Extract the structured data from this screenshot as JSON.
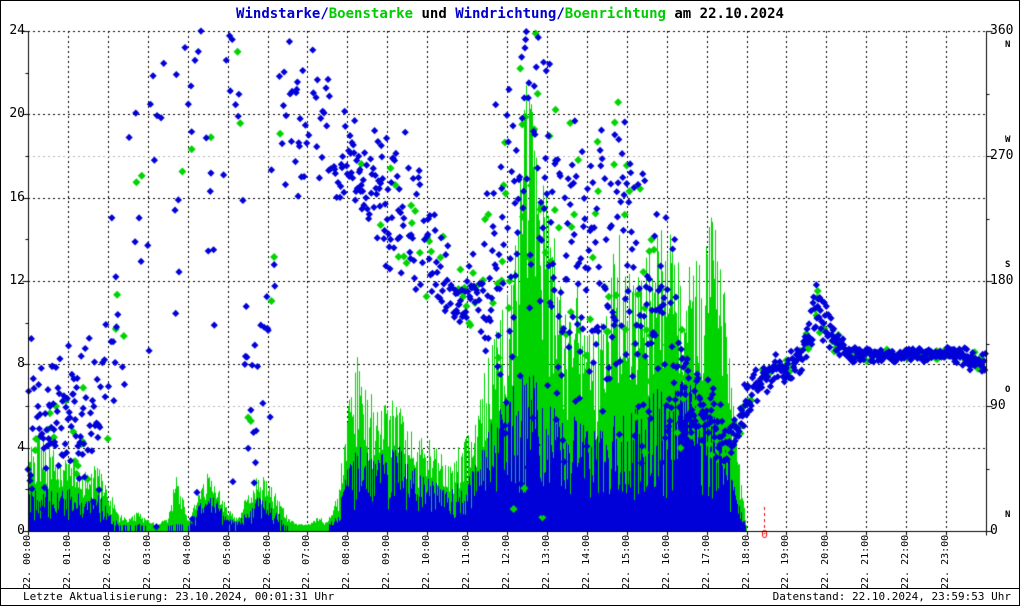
{
  "title": {
    "part_wind": "Windstarke/",
    "part_gust": "Boenstarke",
    "part_mid": " und ",
    "part_winddir": "Windrichtung/",
    "part_gustdir": "Boenrichtung",
    "part_date": " am 22.10.2024"
  },
  "footer": {
    "left": "Letzte Aktualisierung: 23.10.2024, 00:01:31 Uhr",
    "right": "Datenstand: 22.10.2024, 23:59:53 Uhr"
  },
  "colors": {
    "wind": "#0000d8",
    "gust": "#00d400",
    "title_blue": "#0000cc",
    "title_green": "#00cc00",
    "grid_major": "#000000",
    "grid_minor": "#b8b8b8",
    "annotation_red": "#ff0000"
  },
  "axes": {
    "left_ticks": [
      0,
      4,
      8,
      12,
      16,
      20,
      24
    ],
    "right_ticks": [
      {
        "value": 0,
        "compass": "N"
      },
      {
        "value": 90,
        "compass": "O"
      },
      {
        "value": 180,
        "compass": "S"
      },
      {
        "value": 270,
        "compass": "W"
      },
      {
        "value": 360,
        "compass": "N"
      }
    ],
    "x_labels": [
      "22. 00:00",
      "22. 01:00",
      "22. 02:00",
      "22. 03:00",
      "22. 04:00",
      "22. 05:00",
      "22. 06:00",
      "22. 07:00",
      "22. 08:00",
      "22. 09:00",
      "22. 10:00",
      "22. 11:00",
      "22. 12:00",
      "22. 13:00",
      "22. 14:00",
      "22. 15:00",
      "22. 16:00",
      "22. 17:00",
      "22. 18:00",
      "22. 19:00",
      "22. 20:00",
      "22. 21:00",
      "22. 22:00",
      "22. 23:00"
    ]
  },
  "annotation": {
    "red_zero": {
      "hour": 18.45,
      "label": "0"
    }
  },
  "chart_data": {
    "type": "mixed",
    "subtypes": {
      "speed_series": "bar",
      "direction_series": "scatter"
    },
    "x_unit": "hour_of_day",
    "xlim": [
      0,
      24
    ],
    "ylim_left": [
      0,
      24
    ],
    "ylim_right": [
      0,
      360
    ],
    "grid": "dashed_major_every_4_left_and_hourly",
    "minor_grid_at_degrees": [
      90,
      270
    ],
    "anchor_step_hours": 0.25,
    "speed_data_ends_hour": 18.1,
    "seed": 42,
    "series": [
      {
        "name": "Windstarke",
        "role": "wind_speed_bars",
        "color": "#0000d8",
        "avg": [
          1.5,
          1.8,
          1.6,
          1.4,
          1.7,
          1.5,
          1.2,
          1.4,
          1.0,
          0.3,
          0.2,
          0.3,
          0.2,
          0.1,
          0.2,
          0.3,
          0.2,
          0.9,
          1.4,
          1.1,
          0.5,
          0.3,
          0.9,
          1.3,
          1.2,
          0.8,
          0.2,
          0.1,
          0.1,
          0.2,
          0.2,
          0.6,
          2.6,
          3.1,
          3.2,
          2.8,
          3.0,
          3.3,
          2.6,
          2.2,
          2.4,
          1.8,
          1.5,
          1.8,
          2.0,
          2.6,
          3.6,
          4.6,
          5.0,
          5.6,
          6.2,
          5.6,
          5.0,
          4.6,
          4.0,
          4.4,
          4.0,
          3.6,
          4.0,
          4.6,
          4.2,
          4.6,
          5.0,
          5.4,
          5.0,
          5.6,
          6.0,
          5.4,
          5.0,
          4.2,
          3.0,
          1.4,
          0,
          0,
          0,
          0,
          0,
          0,
          0,
          0,
          0,
          0,
          0,
          0,
          0,
          0,
          0,
          0,
          0,
          0,
          0,
          0,
          0,
          0,
          0,
          0
        ]
      },
      {
        "name": "Boenstarke",
        "role": "gust_speed_bars",
        "color": "#00d400",
        "avg": [
          3.6,
          4.6,
          4.0,
          3.0,
          3.4,
          3.0,
          2.6,
          3.0,
          2.0,
          0.8,
          0.5,
          0.9,
          0.5,
          0.3,
          0.7,
          2.8,
          0.4,
          1.6,
          2.6,
          2.0,
          1.0,
          0.6,
          1.8,
          2.6,
          2.2,
          1.5,
          0.6,
          0.3,
          0.3,
          0.6,
          0.5,
          1.6,
          5.6,
          7.6,
          6.6,
          5.2,
          5.6,
          6.0,
          4.6,
          4.0,
          4.6,
          3.6,
          3.0,
          3.6,
          4.2,
          5.6,
          7.6,
          9.2,
          10.5,
          14.5,
          20.5,
          17.5,
          14.5,
          12.0,
          10.0,
          11.0,
          9.5,
          8.6,
          10.5,
          13.5,
          12.0,
          11.0,
          12.5,
          13.0,
          13.5,
          12.0,
          11.5,
          12.5,
          13.0,
          15.0,
          9.0,
          4.0,
          0,
          0,
          0,
          0,
          0,
          0,
          0,
          0,
          0,
          0,
          0,
          0,
          0,
          0,
          0,
          0,
          0,
          0,
          0,
          0,
          0,
          0,
          0,
          0
        ]
      },
      {
        "name": "Windrichtung",
        "role": "wind_direction_points",
        "color": "#0000d8",
        "center": [
          75,
          85,
          70,
          90,
          80,
          72,
          95,
          85,
          100,
          150,
          200,
          240,
          230,
          300,
          330,
          210,
          320,
          340,
          300,
          90,
          350,
          340,
          70,
          95,
          130,
          280,
          320,
          300,
          300,
          310,
          285,
          260,
          258,
          263,
          256,
          248,
          240,
          234,
          224,
          214,
          205,
          190,
          176,
          168,
          166,
          172,
          182,
          192,
          205,
          235,
          280,
          320,
          215,
          195,
          175,
          185,
          178,
          192,
          205,
          195,
          182,
          172,
          162,
          152,
          142,
          122,
          102,
          92,
          82,
          72,
          64,
          76,
          92,
          102,
          112,
          116,
          118,
          121,
          138,
          162,
          150,
          136,
          129,
          127,
          128,
          126,
          127,
          126,
          127,
          128,
          126,
          127,
          128,
          127,
          125,
          122
        ],
        "spread": [
          45,
          45,
          42,
          42,
          42,
          40,
          45,
          48,
          60,
          80,
          90,
          90,
          80,
          60,
          50,
          70,
          50,
          40,
          70,
          60,
          30,
          40,
          55,
          55,
          70,
          60,
          50,
          45,
          45,
          40,
          40,
          35,
          28,
          26,
          30,
          34,
          36,
          40,
          42,
          44,
          30,
          24,
          20,
          18,
          18,
          24,
          50,
          80,
          100,
          110,
          120,
          120,
          110,
          100,
          90,
          85,
          80,
          80,
          85,
          85,
          85,
          90,
          95,
          90,
          70,
          55,
          35,
          28,
          24,
          20,
          16,
          14,
          12,
          10,
          9,
          8,
          8,
          8,
          12,
          14,
          12,
          8,
          5,
          4,
          4,
          3,
          3,
          3,
          3,
          3,
          3,
          3,
          3,
          4,
          5,
          6
        ],
        "density": [
          0.9,
          0.9,
          0.9,
          0.9,
          0.9,
          0.9,
          0.9,
          0.9,
          0.35,
          0.35,
          0.3,
          0.3,
          0.25,
          0.25,
          0.25,
          0.3,
          0.3,
          0.3,
          0.35,
          0.35,
          0.35,
          0.35,
          0.4,
          0.4,
          0.4,
          0.4,
          0.45,
          0.5,
          0.5,
          0.5,
          0.55,
          0.6,
          0.85,
          0.85,
          0.85,
          0.85,
          0.85,
          0.85,
          0.8,
          0.8,
          0.75,
          0.75,
          0.7,
          0.75,
          0.9,
          0.9,
          0.95,
          1,
          1,
          1,
          1,
          1,
          1,
          1,
          1,
          1,
          1,
          1,
          1,
          1,
          1,
          1,
          1,
          1,
          1,
          1,
          1,
          1,
          1,
          1,
          1,
          1,
          1,
          1,
          1,
          1,
          1,
          1,
          1,
          1,
          1,
          1,
          1,
          1,
          1,
          1,
          1,
          1,
          1,
          1,
          1,
          1,
          1,
          1,
          1,
          1
        ]
      },
      {
        "name": "Boenrichtung",
        "role": "gust_direction_points",
        "color": "#00d400",
        "density": [
          0.12,
          0.12,
          0.12,
          0.12,
          0.12,
          0.12,
          0.12,
          0.12,
          0.06,
          0.06,
          0.06,
          0.06,
          0.06,
          0.06,
          0.06,
          0.06,
          0.06,
          0.06,
          0.06,
          0.06,
          0.06,
          0.06,
          0.06,
          0.06,
          0.06,
          0.06,
          0.06,
          0.06,
          0.06,
          0.06,
          0.06,
          0.06,
          0.12,
          0.12,
          0.12,
          0.12,
          0.12,
          0.12,
          0.12,
          0.12,
          0.12,
          0.12,
          0.12,
          0.12,
          0.2,
          0.2,
          0.2,
          0.2,
          0.3,
          0.3,
          0.3,
          0.3,
          0.3,
          0.3,
          0.3,
          0.3,
          0.3,
          0.3,
          0.3,
          0.3,
          0.3,
          0.3,
          0.3,
          0.3,
          0.3,
          0.3,
          0.3,
          0.3,
          0.3,
          0.3,
          0.3,
          0.3,
          0.25,
          0.25,
          0.25,
          0.25,
          0.25,
          0.25,
          0.25,
          0.25,
          0.25,
          0.25,
          0.25,
          0.25,
          0.25,
          0.25,
          0.25,
          0.25,
          0.25,
          0.25,
          0.25,
          0.25,
          0.25,
          0.25,
          0.25,
          0.25
        ]
      }
    ]
  }
}
